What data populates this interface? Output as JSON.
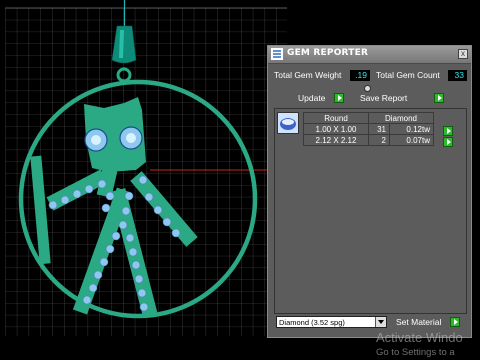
{
  "panel": {
    "title": "GEM REPORTER",
    "close_label": "x",
    "total_weight_label": "Total Gem Weight",
    "total_weight_value": ".19",
    "total_count_label": "Total Gem Count",
    "total_count_value": "33",
    "update_label": "Update",
    "save_report_label": "Save Report",
    "table": {
      "headers": [
        "Round",
        "Diamond"
      ],
      "rows": [
        {
          "size": "1.00 X 1.00",
          "count": "31",
          "weight": "0.12tw"
        },
        {
          "size": "2.12 X 2.12",
          "count": "2",
          "weight": "0.07tw"
        }
      ]
    },
    "material_select": "Diamond    (3.52 spg)",
    "set_material_label": "Set Material"
  },
  "watermark": {
    "line1": "Activate Windo",
    "line2": "Go to Settings to a"
  },
  "colors": {
    "pendant": "#2ba884",
    "gem": "#8ec8ee",
    "grid": "#5a5a5a",
    "accent_arrow": "#2db82d",
    "value_text": "#2ee8ee"
  }
}
